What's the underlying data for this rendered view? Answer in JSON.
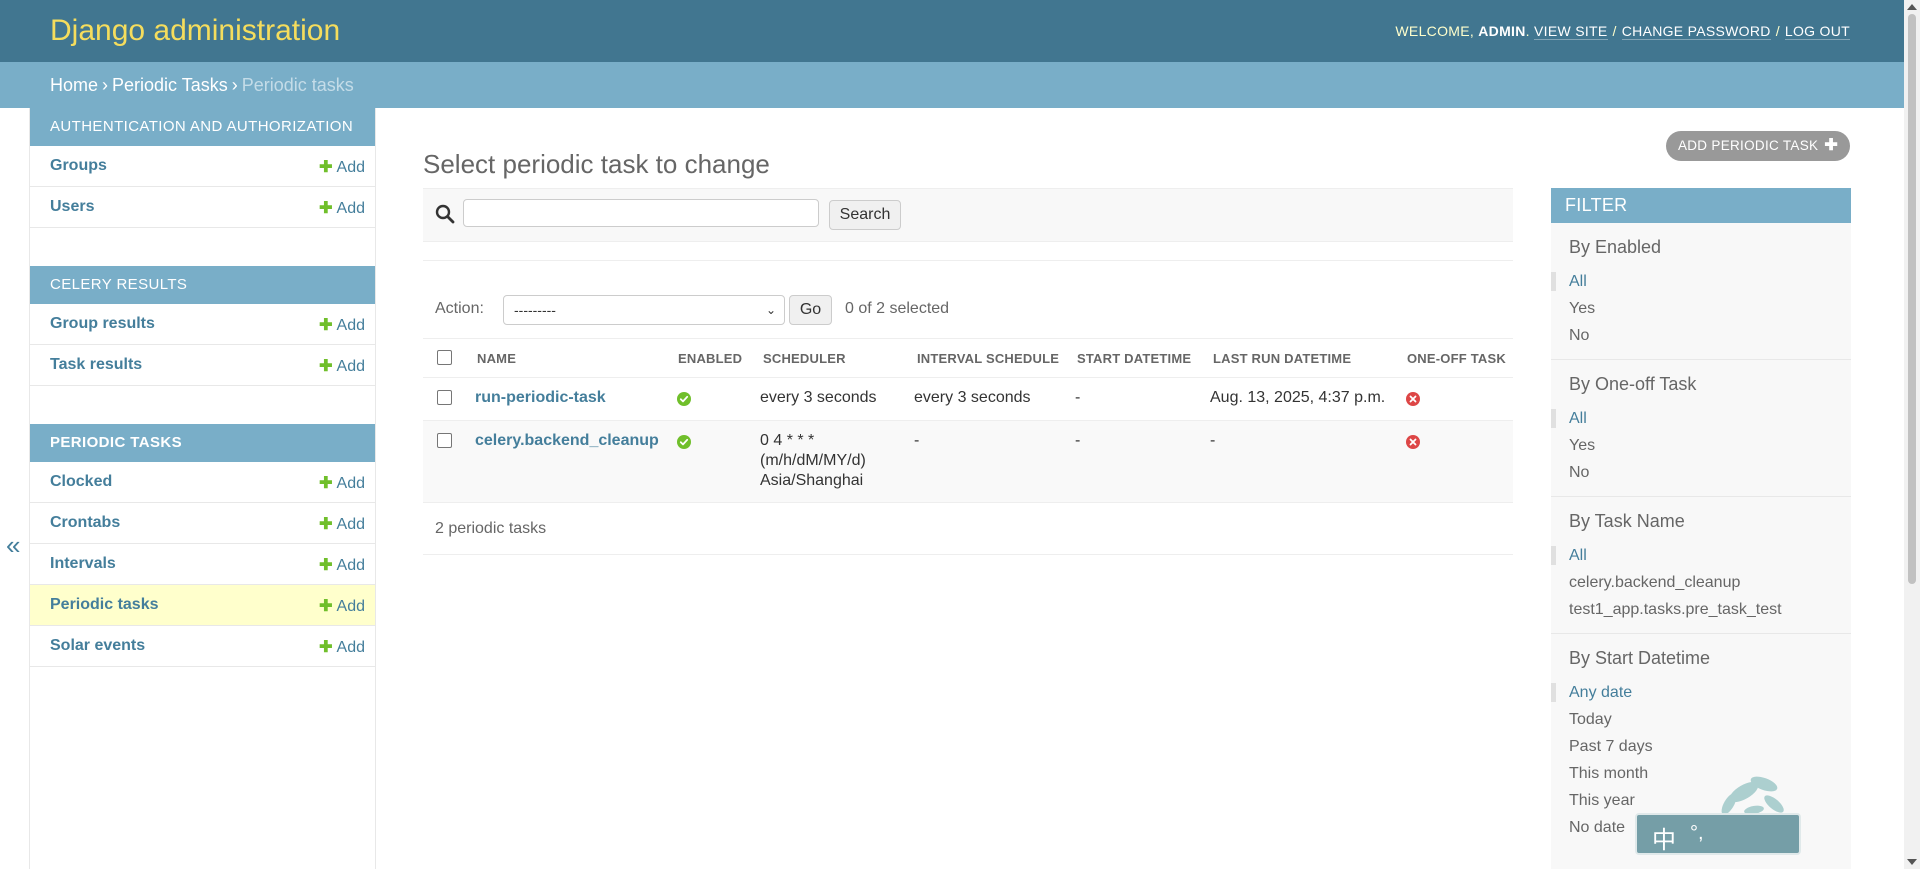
{
  "header": {
    "brand": "Django administration",
    "welcome": "WELCOME,",
    "user": "ADMIN",
    "view_site": "VIEW SITE",
    "change_password": "CHANGE PASSWORD",
    "log_out": "LOG OUT"
  },
  "breadcrumbs": {
    "home": "Home",
    "app": "Periodic Tasks",
    "current": "Periodic tasks"
  },
  "sidebar": {
    "toggle": "«",
    "add_label": "Add",
    "modules": [
      {
        "caption": "AUTHENTICATION AND AUTHORIZATION",
        "items": [
          "Groups",
          "Users"
        ]
      },
      {
        "caption": "CELERY RESULTS",
        "items": [
          "Group results",
          "Task results"
        ]
      },
      {
        "caption": "PERIODIC TASKS",
        "items": [
          "Clocked",
          "Crontabs",
          "Intervals",
          "Periodic tasks",
          "Solar events"
        ]
      }
    ]
  },
  "content": {
    "title": "Select periodic task to change",
    "add_button": "ADD PERIODIC TASK",
    "search_button": "Search",
    "search_value": "",
    "action_label": "Action:",
    "action_selected": "---------",
    "go_button": "Go",
    "selected_count": "0 of 2 selected",
    "columns": [
      "NAME",
      "ENABLED",
      "SCHEDULER",
      "INTERVAL SCHEDULE",
      "START DATETIME",
      "LAST RUN DATETIME",
      "ONE-OFF TASK"
    ],
    "rows": [
      {
        "name": "run-periodic-task",
        "enabled": true,
        "scheduler": "every 3 seconds",
        "interval": "every 3 seconds",
        "start": "-",
        "last_run": "Aug. 13, 2025, 4:37 p.m.",
        "one_off": false
      },
      {
        "name": "celery.backend_cleanup",
        "enabled": true,
        "scheduler_line1": "0 4 * * *",
        "scheduler_line2": "(m/h/dM/MY/d)",
        "scheduler_line3": "Asia/Shanghai",
        "interval": "-",
        "start": "-",
        "last_run": "-",
        "one_off": false
      }
    ],
    "result_count": "2 periodic tasks"
  },
  "filter": {
    "title": "FILTER",
    "groups": [
      {
        "title": "By Enabled",
        "items": [
          "All",
          "Yes",
          "No"
        ]
      },
      {
        "title": "By One-off Task",
        "items": [
          "All",
          "Yes",
          "No"
        ]
      },
      {
        "title": "By Task Name",
        "items": [
          "All",
          "celery.backend_cleanup",
          "test1_app.tasks.pre_task_test"
        ]
      },
      {
        "title": "By Start Datetime",
        "items": [
          "Any date",
          "Today",
          "Past 7 days",
          "This month",
          "This year",
          "No date"
        ]
      }
    ]
  },
  "ime": {
    "label1": "中",
    "label2": "°,"
  },
  "colors": {
    "header": "#417690",
    "breadcrumb": "#79aec8",
    "link": "#447e9b",
    "brand": "#f5dd5d",
    "add_plus": "#70bf2b",
    "no_icon": "#dd4646"
  }
}
